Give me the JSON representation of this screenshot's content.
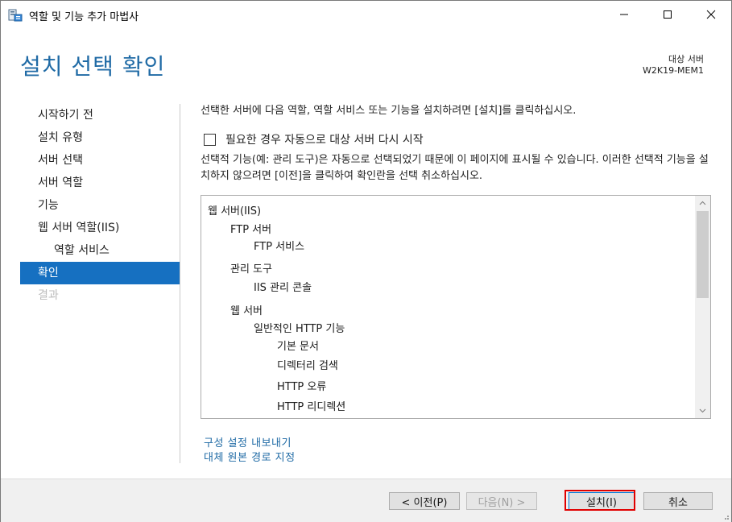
{
  "window": {
    "title": "역할 및 기능 추가 마법사"
  },
  "header": {
    "title": "설치 선택 확인",
    "destination_label": "대상 서버",
    "destination_value": "W2K19-MEM1"
  },
  "nav": {
    "items": [
      {
        "label": "시작하기 전"
      },
      {
        "label": "설치 유형"
      },
      {
        "label": "서버 선택"
      },
      {
        "label": "서버 역할"
      },
      {
        "label": "기능"
      },
      {
        "label": "웹 서버 역할(IIS)"
      },
      {
        "label": "역할 서비스"
      },
      {
        "label": "확인"
      },
      {
        "label": "결과"
      }
    ]
  },
  "content": {
    "intro": "선택한 서버에 다음 역할, 역할 서비스 또는 기능을 설치하려면 [설치]를 클릭하십시오.",
    "restart_label": "필요한 경우 자동으로 대상 서버 다시 시작",
    "description": "선택적 기능(예: 관리 도구)은 자동으로 선택되었기 때문에 이 페이지에 표시될 수 있습니다. 이러한 선택적 기능을 설치하지 않으려면 [이전]을 클릭하여 확인란을 선택 취소하십시오.",
    "list": [
      {
        "text": "웹 서버(IIS)",
        "level": 0
      },
      {
        "text": "FTP 서버",
        "level": 1
      },
      {
        "text": "FTP 서비스",
        "level": 2
      },
      {
        "text": "관리 도구",
        "level": 1
      },
      {
        "text": "IIS 관리 콘솔",
        "level": 2
      },
      {
        "text": "웹 서버",
        "level": 1
      },
      {
        "text": "일반적인 HTTP 기능",
        "level": 2
      },
      {
        "text": "기본 문서",
        "level": 3
      },
      {
        "text": "디렉터리 검색",
        "level": 3
      },
      {
        "text": "HTTP 오류",
        "level": 3
      },
      {
        "text": "HTTP 리디렉션",
        "level": 3
      }
    ],
    "links": {
      "export": "구성 설정 내보내기",
      "alternate_source": "대체 원본 경로 지정"
    }
  },
  "footer": {
    "prev": "< 이전(P)",
    "next": "다음(N) >",
    "install": "설치(I)",
    "cancel": "취소"
  }
}
